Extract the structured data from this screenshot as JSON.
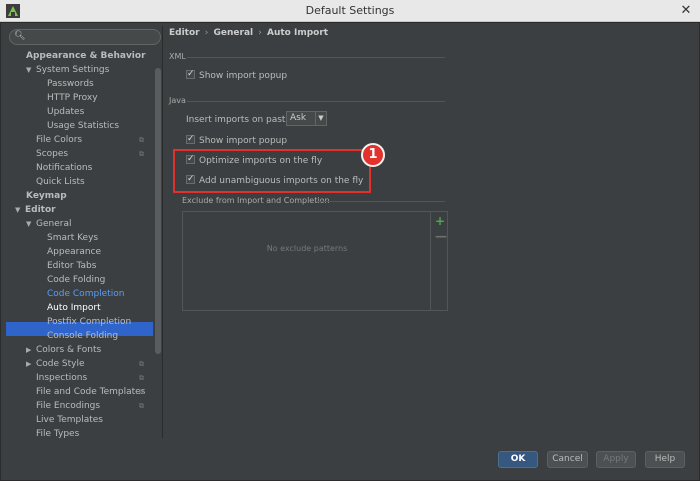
{
  "window": {
    "title": "Default Settings"
  },
  "search": {
    "placeholder": ""
  },
  "tree": {
    "items": [
      {
        "label": "Appearance & Behavior",
        "arrow": ""
      },
      {
        "label": "System Settings",
        "arrow": "▼"
      },
      {
        "label": "Passwords",
        "arrow": ""
      },
      {
        "label": "HTTP Proxy",
        "arrow": ""
      },
      {
        "label": "Updates",
        "arrow": ""
      },
      {
        "label": "Usage Statistics",
        "arrow": ""
      },
      {
        "label": "File Colors",
        "arrow": ""
      },
      {
        "label": "Scopes",
        "arrow": ""
      },
      {
        "label": "Notifications",
        "arrow": ""
      },
      {
        "label": "Quick Lists",
        "arrow": ""
      },
      {
        "label": "Keymap",
        "arrow": ""
      },
      {
        "label": "Editor",
        "arrow": "▼"
      },
      {
        "label": "General",
        "arrow": "▼"
      },
      {
        "label": "Smart Keys",
        "arrow": ""
      },
      {
        "label": "Appearance",
        "arrow": ""
      },
      {
        "label": "Editor Tabs",
        "arrow": ""
      },
      {
        "label": "Code Folding",
        "arrow": ""
      },
      {
        "label": "Code Completion",
        "arrow": ""
      },
      {
        "label": "Auto Import",
        "arrow": ""
      },
      {
        "label": "Postfix Completion",
        "arrow": ""
      },
      {
        "label": "Console Folding",
        "arrow": ""
      },
      {
        "label": "Colors & Fonts",
        "arrow": "▶"
      },
      {
        "label": "Code Style",
        "arrow": "▶"
      },
      {
        "label": "Inspections",
        "arrow": ""
      },
      {
        "label": "File and Code Templates",
        "arrow": ""
      },
      {
        "label": "File Encodings",
        "arrow": ""
      },
      {
        "label": "Live Templates",
        "arrow": ""
      },
      {
        "label": "File Types",
        "arrow": ""
      }
    ]
  },
  "breadcrumb": {
    "part1": "Editor",
    "part2": "General",
    "part3": "Auto Import",
    "sep": "›"
  },
  "xml": {
    "section_label": "XML",
    "show_import_popup": "Show import popup"
  },
  "java": {
    "section_label": "Java",
    "insert_imports_label": "Insert imports on paste:",
    "insert_imports_value": "Ask",
    "show_import_popup": "Show import popup",
    "optimize_imports": "Optimize imports on the fly",
    "add_unambiguous": "Add unambiguous imports on the fly"
  },
  "annotation": {
    "badge": "1"
  },
  "exclude": {
    "label": "Exclude from Import and Completion",
    "empty_text": "No exclude patterns",
    "add_symbol": "+",
    "remove_symbol": "—"
  },
  "footer": {
    "ok": "OK",
    "cancel": "Cancel",
    "apply": "Apply",
    "help": "Help"
  },
  "colors": {
    "background": "#3c3f41",
    "selection": "#2f65ca",
    "link_text": "#589df6",
    "highlight": "#e0312c",
    "ok_button": "#365880"
  }
}
